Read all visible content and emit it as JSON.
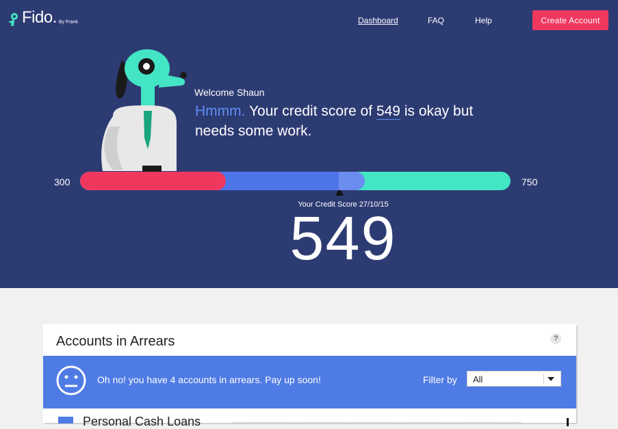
{
  "header": {
    "brand": "Fido.",
    "byline": "By Frank",
    "nav": [
      "Dashboard",
      "FAQ",
      "Help"
    ],
    "cta": "Create Account"
  },
  "hero": {
    "welcome": "Welcome Shaun",
    "message_lead": "Hmmm.",
    "message_mid": " Your credit score of ",
    "score_inline": "549",
    "message_tail": " is okay but needs some work.",
    "range_min": "300",
    "range_max": "750",
    "caption": "Your Credit Score 27/10/15",
    "score": "549",
    "score_value": 549,
    "colors": {
      "bad": "#f0385f",
      "ok": "#4d75e8",
      "good": "#43e5c4"
    }
  },
  "arrears": {
    "title": "Accounts in Arrears",
    "help": "?",
    "alert_text": "Oh no! you have 4 accounts in arrears. Pay up soon!",
    "filter_label": "Filter by",
    "filter_value": "All",
    "row_label": "Personal Cash Loans"
  }
}
